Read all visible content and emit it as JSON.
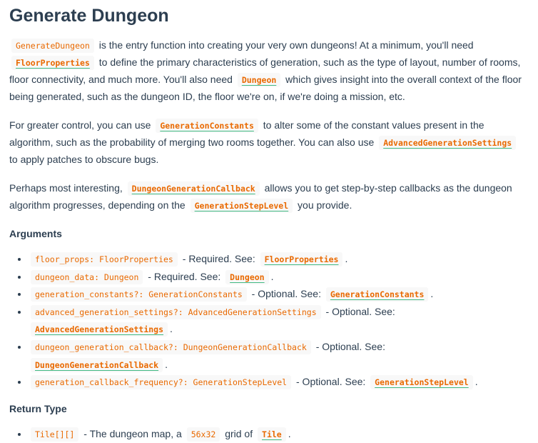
{
  "title": "Generate Dungeon",
  "p1": {
    "code1": "GenerateDungeon",
    "t1": " is the entry function into creating your very own dungeons! At a minimum, you'll need ",
    "link1": "FloorProperties",
    "t2": " to define the primary characteristics of generation, such as the type of layout, number of rooms, floor connectivity, and much more. You'll also need ",
    "link2": "Dungeon",
    "t3": " which gives insight into the overall context of the floor being generated, such as the dungeon ID, the floor we're on, if we're doing a mission, etc."
  },
  "p2": {
    "t1": "For greater control, you can use ",
    "link1": "GenerationConstants",
    "t2": " to alter some of the constant values present in the algorithm, such as the probability of merging two rooms together. You can also use ",
    "link2": "AdvancedGenerationSettings",
    "t3": " to apply patches to obscure bugs."
  },
  "p3": {
    "t1": "Perhaps most interesting, ",
    "link1": "DungeonGenerationCallback",
    "t2": " allows you to get step-by-step callbacks as the dungeon algorithm progresses, depending on the ",
    "link2": "GenerationStepLevel",
    "t3": " you provide."
  },
  "arguments_heading": "Arguments",
  "arguments": [
    {
      "code": "floor_props: FloorProperties",
      "text": " - Required. See: ",
      "link": "FloorProperties",
      "end": "."
    },
    {
      "code": "dungeon_data: Dungeon",
      "text": " - Required. See: ",
      "link": "Dungeon",
      "end": "."
    },
    {
      "code": "generation_constants?: GenerationConstants",
      "text": " - Optional. See: ",
      "link": "GenerationConstants",
      "end": "."
    },
    {
      "code": "advanced_generation_settings?: AdvancedGenerationSettings",
      "text": " - Optional. See: ",
      "link": "AdvancedGenerationSettings",
      "end": "."
    },
    {
      "code": "dungeon_generation_callback?: DungeonGenerationCallback",
      "text": " - Optional. See: ",
      "link": "DungeonGenerationCallback",
      "end": "."
    },
    {
      "code": "generation_callback_frequency?: GenerationStepLevel",
      "text": " - Optional. See: ",
      "link": "GenerationStepLevel",
      "end": "."
    }
  ],
  "return_heading": "Return Type",
  "return": {
    "code": "Tile[][]",
    "t1": " - The dungeon map, a ",
    "code2": "56x32",
    "t2": " grid of ",
    "link": "Tile",
    "end": "."
  },
  "colors": {
    "text": "#2c3e50",
    "code": "#e96900",
    "code_bg": "#f8f8f8",
    "link_underline": "#42b983"
  }
}
